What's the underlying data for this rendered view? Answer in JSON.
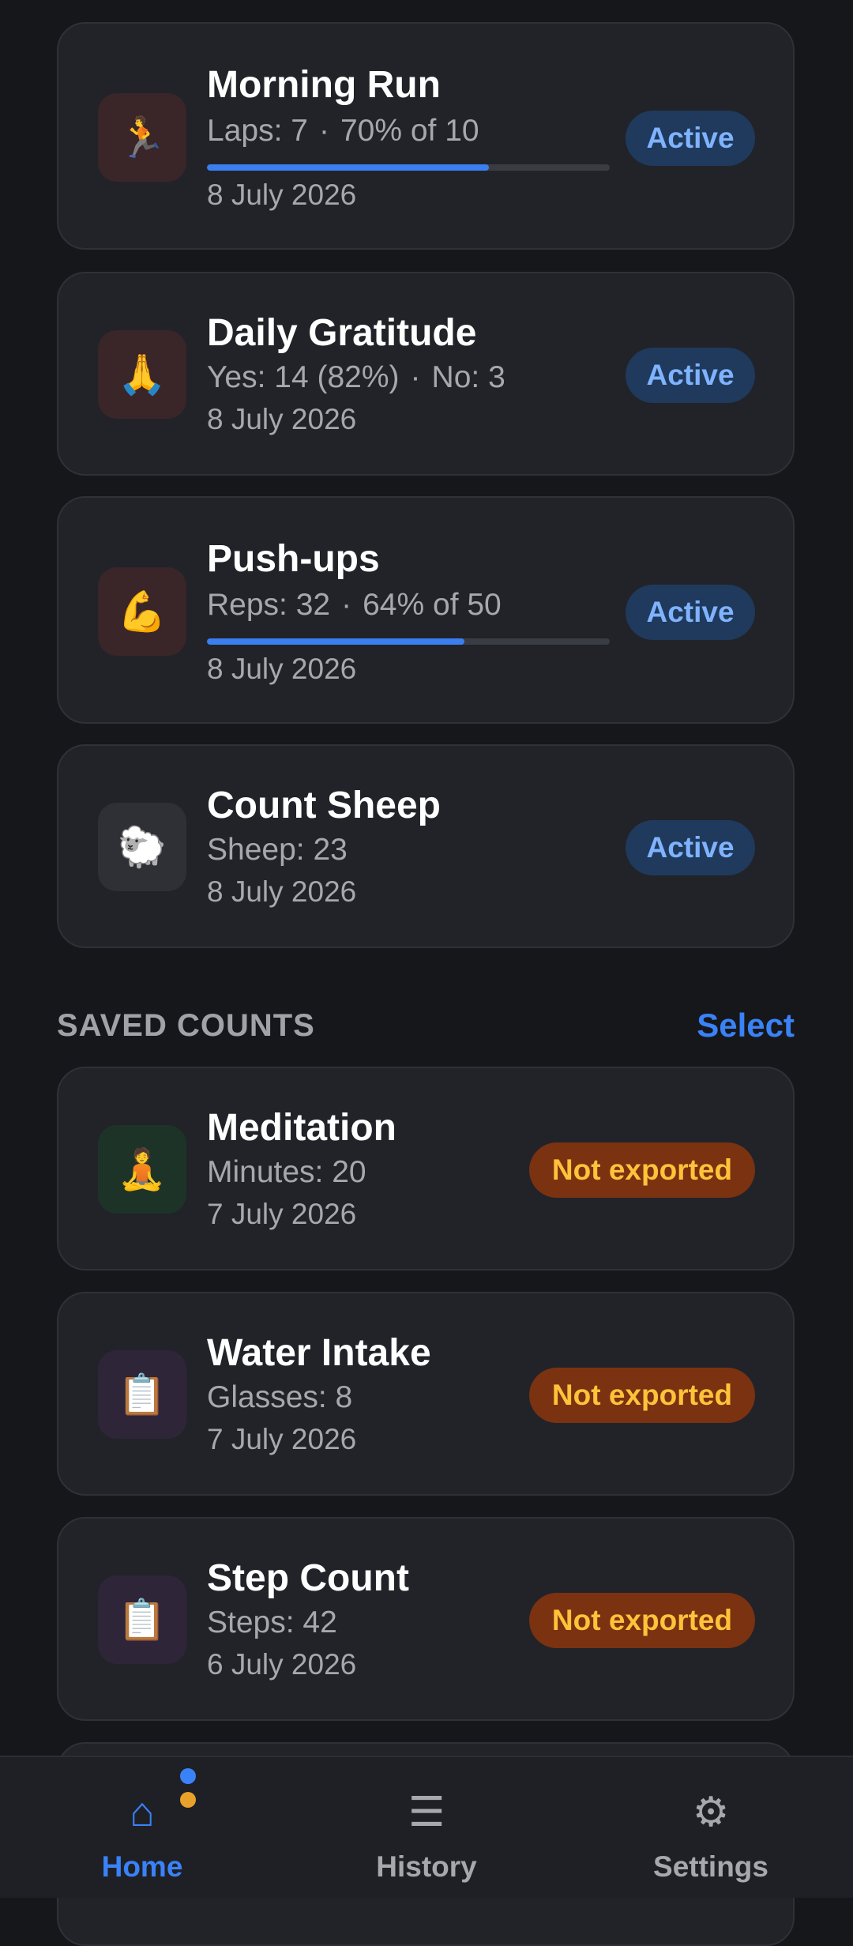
{
  "colors": {
    "background": "#16171b",
    "card": "#212329",
    "accent": "#3a82f7",
    "active_badge_bg": "#1f3a5c",
    "active_badge_text": "#7fb3ff",
    "not_exported_bg": "#7a3210",
    "not_exported_text": "#ffc23a"
  },
  "active_counts": [
    {
      "icon": "🏃",
      "icon_name": "runner-icon",
      "title": "Morning Run",
      "stat": "Laps: 7",
      "detail": "70% of 10",
      "progress": 0.7,
      "date": "8 July 2026",
      "status": "Active"
    },
    {
      "icon": "🙏",
      "icon_name": "praying-hands-icon",
      "title": "Daily Gratitude",
      "stat": "Yes: 14 (82%)",
      "detail": "No: 3",
      "date": "8 July 2026",
      "status": "Active"
    },
    {
      "icon": "💪",
      "icon_name": "flexed-biceps-icon",
      "title": "Push-ups",
      "stat": "Reps: 32",
      "detail": "64% of 50",
      "progress": 0.64,
      "date": "8 July 2026",
      "status": "Active"
    },
    {
      "icon": "🐑",
      "icon_name": "sheep-icon",
      "title": "Count Sheep",
      "stat": "Sheep: 23",
      "date": "8 July 2026",
      "status": "Active"
    }
  ],
  "saved_section": {
    "title": "SAVED COUNTS",
    "action": "Select"
  },
  "saved_counts": [
    {
      "icon": "🧘",
      "icon_name": "meditation-icon",
      "title": "Meditation",
      "stat": "Minutes: 20",
      "date": "7 July 2026",
      "status": "Not exported"
    },
    {
      "icon": "📋",
      "icon_name": "clipboard-icon",
      "title": "Water Intake",
      "stat": "Glasses: 8",
      "date": "7 July 2026",
      "status": "Not exported"
    },
    {
      "icon": "📋",
      "icon_name": "clipboard-icon",
      "title": "Step Count",
      "stat": "Steps: 42",
      "date": "6 July 2026",
      "status": "Not exported"
    }
  ],
  "nav": {
    "home_icon": "⌂",
    "home": "Home",
    "history_icon": "☰",
    "history": "History",
    "settings_icon": "⚙",
    "settings": "Settings"
  }
}
